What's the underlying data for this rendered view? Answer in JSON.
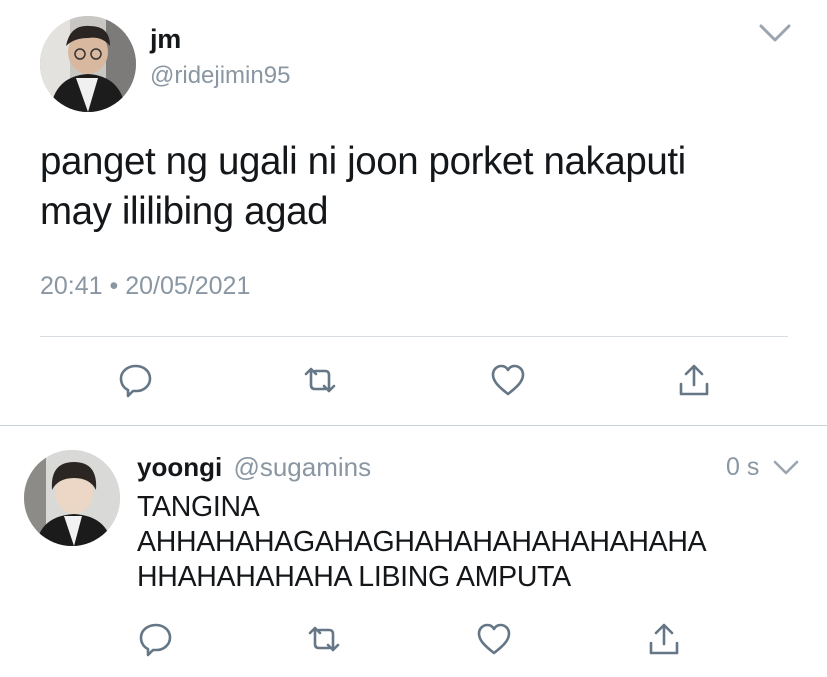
{
  "tweet": {
    "display_name": "jm",
    "handle": "@ridejimin95",
    "text_lines": [
      "panget ng ugali ni joon porket nakaputi",
      "may ililibing agad"
    ],
    "time": "20:41",
    "separator": "•",
    "date": "20/05/2021",
    "menu_icon": "chevron-down-icon",
    "actions": [
      "reply-icon",
      "retweet-icon",
      "like-icon",
      "share-icon"
    ]
  },
  "reply": {
    "display_name": "yoongi",
    "handle": "@sugamins",
    "time": "0 s",
    "text_lines": [
      "TANGINA",
      "AHHAHAHAGAHAGHAHAHAHAHAHAHAHA",
      "HHAHAHAHAHA LIBING AMPUTA"
    ],
    "menu_icon": "chevron-down-icon",
    "actions": [
      "reply-icon",
      "retweet-icon",
      "like-icon",
      "share-icon"
    ]
  },
  "colors": {
    "text": "#14171a",
    "secondary_text": "#8a97a3",
    "icon": "#657786",
    "separator": "#d7dde2",
    "background": "#ffffff"
  }
}
